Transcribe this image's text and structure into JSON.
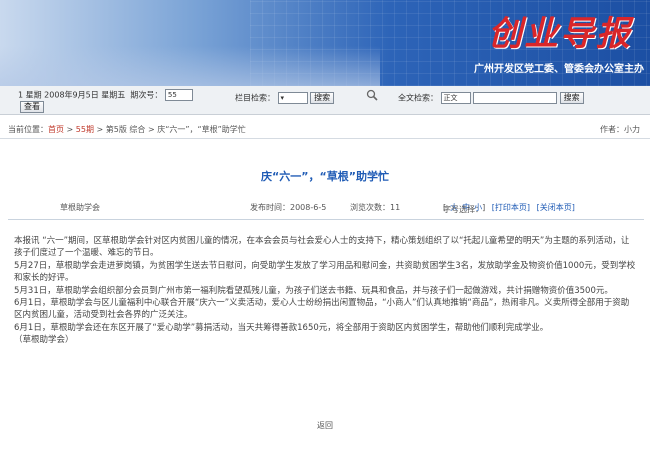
{
  "banner": {
    "logo_text": "创业导报",
    "subtitle": "广州开发区党工委、管委会办公室主办"
  },
  "toolbar": {
    "date_text": "1 星期 2008年9月5日 星期五",
    "issue_label": "期次号：",
    "issue_value": "55",
    "view_button": "查看",
    "column_search_label": "栏目检索：",
    "column_search_button": "搜索",
    "fulltext_label": "全文检索：",
    "fulltext_select": "正文",
    "fulltext_button": "搜索"
  },
  "breadcrumb": {
    "prefix": "当前位置：",
    "home": "首页",
    "sep1": " > ",
    "issue": "55期",
    "rest": " > 第5版 综合 > 庆“六一”，“草根”助学忙",
    "author": "作者：小力"
  },
  "article": {
    "title": "庆“六一”，“草根”助学忙",
    "meta_source": "草根助学会",
    "meta_date": "发布时间：2008-6-5",
    "meta_views": "浏览次数：11",
    "font_label": "字号选择：",
    "font_sizes": [
      "大",
      "中",
      "小"
    ],
    "print_link": "[打印本页]",
    "close_link": "[关闭本页]",
    "paragraphs": [
      "本报讯 “六一”期间，区草根助学会针对区内贫困儿童的情况，在本会会员与社会爱心人士的支持下，精心策划组织了以“托起儿童希望的明天”为主题的系列活动，让孩子们度过了一个温暖、难忘的节日。",
      "5月27日，草根助学会走进萝岗镇，为贫困学生送去节日慰问，向受助学生发放了学习用品和慰问金，共资助贫困学生3名，发放助学金及物资价值1000元，受到学校和家长的好评。",
      "5月31日，草根助学会组织部分会员到广州市第一福利院看望孤残儿童，为孩子们送去书籍、玩具和食品，并与孩子们一起做游戏，共计捐赠物资价值3500元。",
      "6月1日，草根助学会与区儿童福利中心联合开展“庆六一”义卖活动，爱心人士纷纷捐出闲置物品，“小商人”们认真地推销“商品”，热闹非凡。义卖所得全部用于资助区内贫困儿童，活动受到社会各界的广泛关注。",
      "6月1日，草根助学会还在东区开展了“爱心助学”募捐活动，当天共筹得善款1650元，将全部用于资助区内贫困学生，帮助他们顺利完成学业。",
      "（草根助学会）"
    ]
  },
  "footer": {
    "back_top": "返回"
  }
}
